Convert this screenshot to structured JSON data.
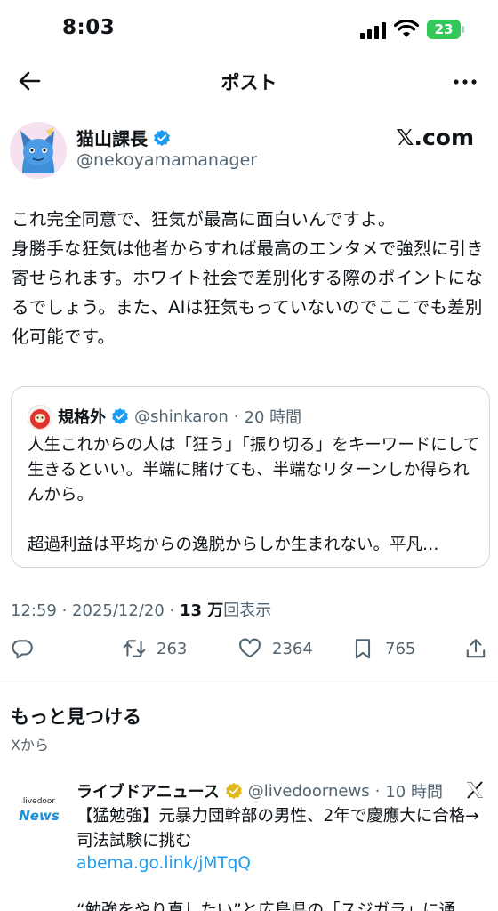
{
  "status": {
    "time": "8:03",
    "battery": "23"
  },
  "nav": {
    "title": "ポスト"
  },
  "author": {
    "name": "猫山課長",
    "handle": "@nekoyamamanager",
    "brand": "𝕏.com"
  },
  "tweet": {
    "text": "これ完全同意で、狂気が最高に面白いんですよ。\n身勝手な狂気は他者からすれば最高のエンタメで強烈に引き寄せられます。ホワイト社会で差別化する際のポイントになるでしょう。また、AIは狂気もっていないのでここでも差別化可能です。"
  },
  "quote": {
    "name": "規格外",
    "handle": "@shinkaron",
    "time": "20 時間",
    "text": "人生これからの人は「狂う」「振り切る」をキーワードにして生きるといい。半端に賭けても、半端なリターンしか得られんから。\n\n超過利益は平均からの逸脱からしか生まれない。平凡…"
  },
  "meta": {
    "time_date": "12:59 · 2025/12/20 · ",
    "views_count": "13 万",
    "views_label": "回表示"
  },
  "actions": {
    "retweets": "263",
    "likes": "2364",
    "bookmarks": "765"
  },
  "discover": {
    "title": "もっと見つける",
    "subtitle": "Xから"
  },
  "news": {
    "logo_top": "livedoor",
    "logo_main": "News",
    "name": "ライブドアニュース",
    "handle": "@livedoornews",
    "time": "10 時間",
    "text": "【猛勉強】元暴力団幹部の男性、2年で慶應大に合格→司法試験に挑む",
    "link": "abema.go.link/jMTqQ",
    "text2": "“勉強をやり直したい”と広島県の「スジガラ」に通"
  },
  "colors": {
    "verified_blue": "#1d9bf0",
    "verified_gold": "#e2b719",
    "battery_green": "#34c759",
    "secondary_text": "#536471"
  }
}
